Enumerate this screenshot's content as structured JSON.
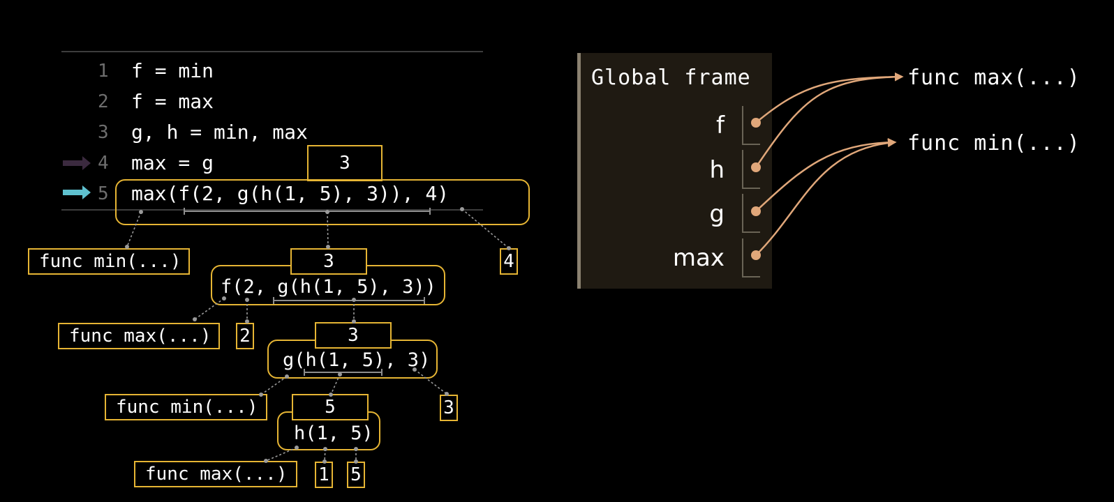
{
  "code": {
    "lines": [
      {
        "num": "1",
        "text": "f = min"
      },
      {
        "num": "2",
        "text": "f = max"
      },
      {
        "num": "3",
        "text": "g, h = min, max"
      },
      {
        "num": "4",
        "text": "max = g"
      },
      {
        "num": "5",
        "text": "max(f(2, g(h(1, 5), 3)), 4)"
      }
    ],
    "arrow_prev_color": "#3b2a3f",
    "arrow_current_color": "#5fc1cf"
  },
  "tree": {
    "line4_value": "3",
    "expr_top": {
      "value": "3",
      "text": "max(f(2, g(h(1, 5), 3)), 4)"
    },
    "top_func": "func min(...)",
    "top_arg4": "4",
    "expr_f": {
      "value": "3",
      "text": "f(2, g(h(1, 5), 3))"
    },
    "f_func": "func max(...)",
    "f_arg2": "2",
    "expr_g": {
      "value": "3",
      "text": "g(h(1, 5), 3)"
    },
    "g_func": "func min(...)",
    "g_arg3": "3",
    "expr_h": {
      "value": "5",
      "text": "h(1, 5)"
    },
    "h_func": "func max(...)",
    "h_arg1": "1",
    "h_arg5": "5"
  },
  "frame": {
    "title": "Global frame",
    "vars": [
      "f",
      "h",
      "g",
      "max"
    ]
  },
  "objects": {
    "max_obj": "func max(...)",
    "min_obj": "func min(...)"
  },
  "colors": {
    "accent": "#e6b534",
    "pointer": "#e0a77a"
  }
}
